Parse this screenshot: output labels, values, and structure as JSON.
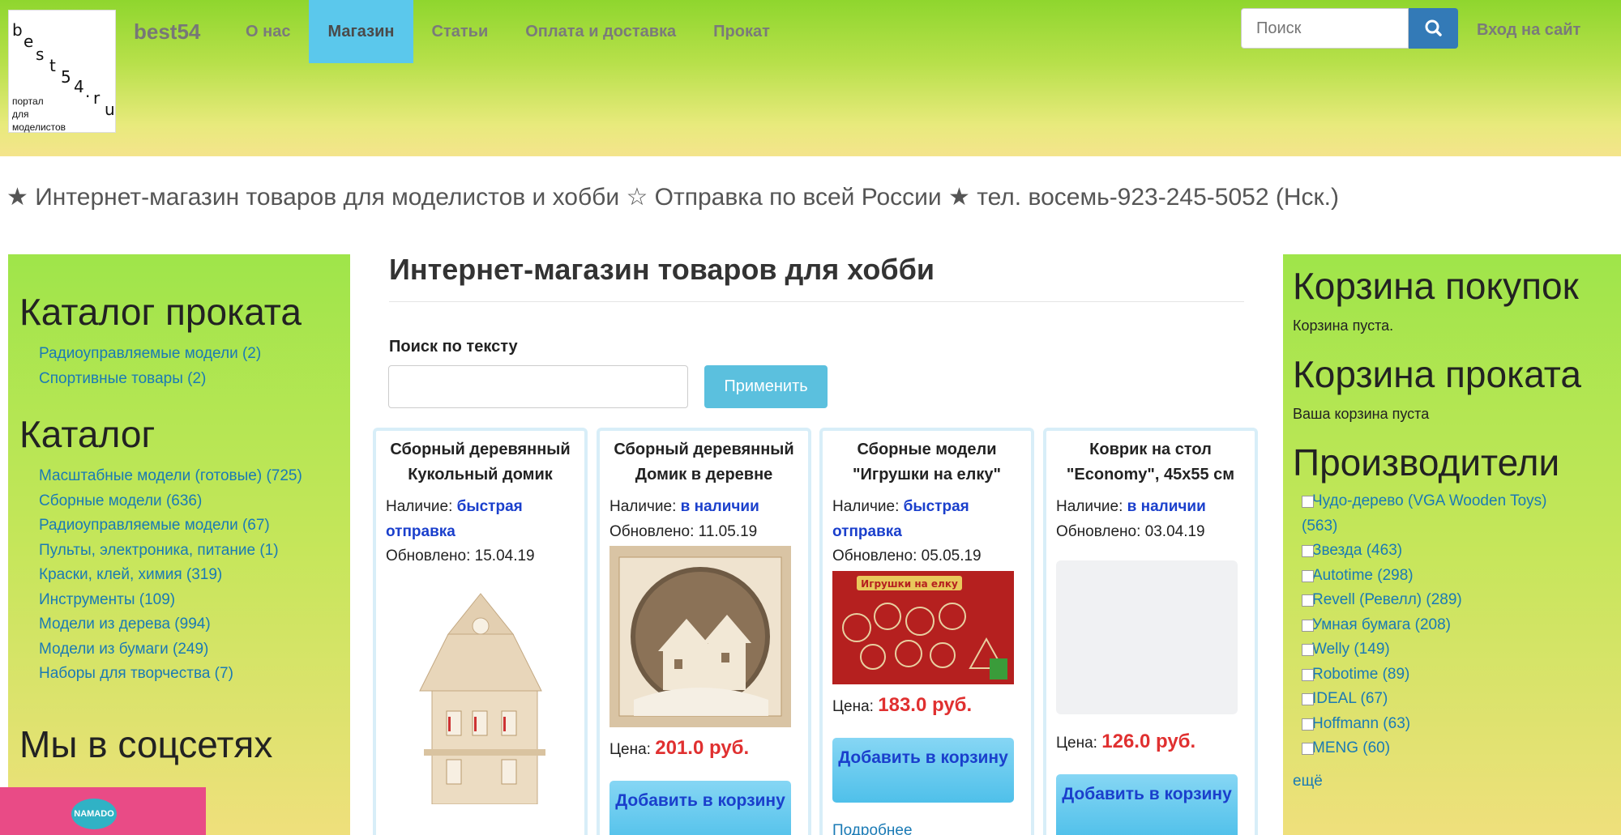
{
  "logo": {
    "chars": [
      "b",
      "e",
      "s",
      "t",
      "5",
      "4",
      ".",
      "r",
      "u"
    ],
    "line1": "портал",
    "line2": "для",
    "line3": "моделистов"
  },
  "brand": "best54",
  "nav": [
    "О нас",
    "Магазин",
    "Статьи",
    "Оплата и доставка",
    "Прокат"
  ],
  "nav_active": "Магазин",
  "search": {
    "placeholder": "Поиск"
  },
  "login": "Вход на сайт",
  "tagline": "★ Интернет-магазин товаров для моделистов и хобби ☆ Отправка по всей России ★ тел. восемь-923-245-5052 (Нск.)",
  "left": {
    "rental_heading": "Каталог проката",
    "rental_items": [
      "Радиоуправляемые модели (2)",
      "Спортивные товары (2)"
    ],
    "catalog_heading": "Каталог",
    "catalog_items": [
      "Масштабные модели (готовые) (725)",
      "Сборные модели (636)",
      "Радиоуправляемые модели (67)",
      "Пульты, электроника, питание (1)",
      "Краски, клей, химия (319)",
      "Инструменты (109)",
      "Модели из дерева (994)",
      "Модели из бумаги (249)",
      "Наборы для творчества (7)"
    ],
    "social_heading": "Мы в соцсетях"
  },
  "main": {
    "title": "Интернет-магазин товаров для хобби",
    "search_label": "Поиск по тексту",
    "apply": "Применить",
    "availability_label": "Наличие:",
    "updated_label": "Обновлено:",
    "price_label": "Цена:",
    "add_label": "Добавить в корзину",
    "more_label": "Подробнее",
    "products": [
      {
        "title": "Сборный деревянный Кукольный домик",
        "availability": "быстрая отправка",
        "updated": "15.04.19"
      },
      {
        "title": "Сборный деревянный Домик в деревне",
        "availability": "в наличии",
        "updated": "11.05.19",
        "price": "201.0 руб."
      },
      {
        "title": "Сборные модели \"Игрушки на елку\"",
        "availability": "быстрая отправка",
        "updated": "05.05.19",
        "price": "183.0 руб.",
        "image_text": "Игрушки на елку"
      },
      {
        "title": "Коврик на стол \"Economy\", 45х55 см",
        "availability": "в наличии",
        "updated": "03.04.19",
        "price": "126.0 руб."
      }
    ]
  },
  "right": {
    "cart_heading": "Корзина покупок",
    "cart_text": "Корзина пуста.",
    "rental_cart_heading": "Корзина проката",
    "rental_cart_text": "Ваша корзина пуста",
    "manufacturers_heading": "Производители",
    "manufacturers": [
      "Чудо-дерево (VGA Wooden Toys)",
      "(563)",
      "Звезда (463)",
      "Autotime (298)",
      "Revell (Ревелл) (289)",
      "Умная бумага (208)",
      "Welly (149)",
      "Robotime (89)",
      "IDEAL (67)",
      "Hoffmann (63)",
      "MENG (60)"
    ],
    "more": "ещё"
  },
  "overlay": {
    "namado": "NAMADO"
  }
}
